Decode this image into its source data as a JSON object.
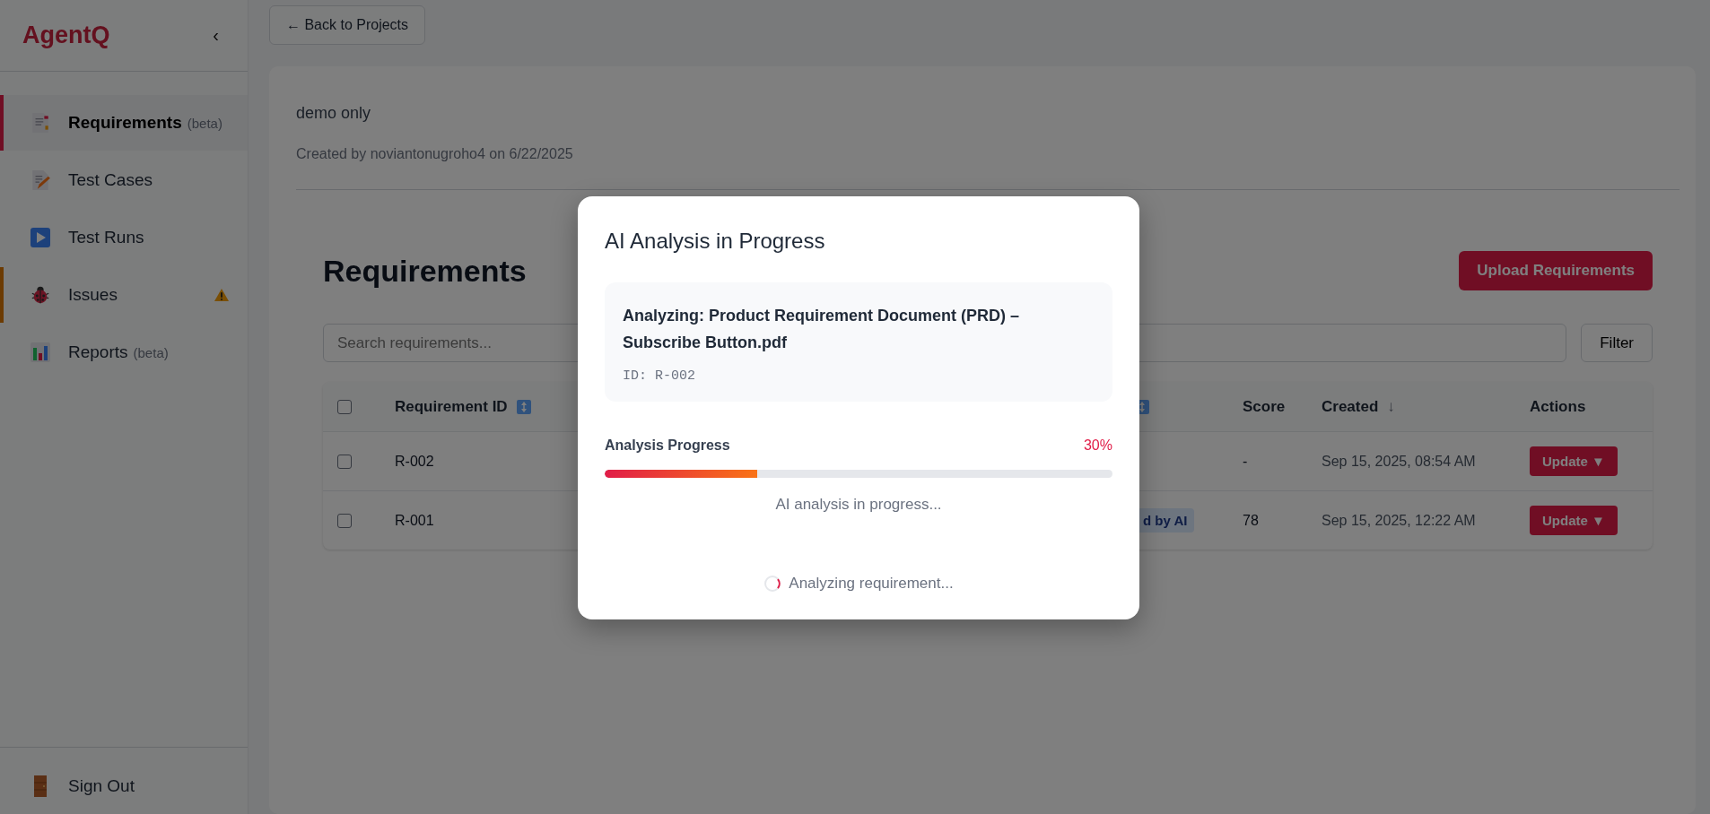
{
  "sidebar": {
    "logo": "AgentQ",
    "collapse": "‹",
    "items": [
      {
        "kind": "document",
        "label": "Requirements",
        "tag": "(beta)",
        "selected": true,
        "alert": false
      },
      {
        "kind": "pencil",
        "label": "Test Cases",
        "selected": false,
        "alert": false
      },
      {
        "kind": "play",
        "label": "Test Runs",
        "selected": false,
        "alert": false
      },
      {
        "kind": "bug",
        "label": "Issues",
        "selected": false,
        "alert": true
      },
      {
        "kind": "chart",
        "label": "Reports",
        "tag": "(beta)",
        "selected": false,
        "alert": false
      }
    ],
    "footer": {
      "kind": "door",
      "label": "Sign Out"
    }
  },
  "back_button": "← Back to Projects",
  "project": {
    "name": "demo only",
    "meta": "Created by noviantonugroho4 on 6/22/2025"
  },
  "page": {
    "title": "Requirements",
    "upload_button": "Upload Requirements",
    "search": {
      "placeholder": "Search requirements..."
    },
    "filter_button": "Filter"
  },
  "table": {
    "select_all_checked": false,
    "columns": [
      {
        "label": "Requirement ID",
        "sortable": true
      },
      {
        "sortable": true
      },
      {
        "label": "Score",
        "sortable": false
      },
      {
        "label": "Created",
        "sort_indicator": "↓",
        "sortable": false
      },
      {
        "label": "Actions",
        "sortable": false
      }
    ],
    "rows": [
      {
        "checked": false,
        "requirement_id": "R-002",
        "score": "-",
        "created": "Sep 15, 2025, 08:54 AM",
        "action": "Update ▼"
      },
      {
        "checked": false,
        "requirement_id": "R-001",
        "column_3": "d by AI",
        "score": "78",
        "created": "Sep 15, 2025, 12:22 AM",
        "action": "Update ▼"
      }
    ]
  },
  "modal": {
    "title": "AI Analysis in Progress",
    "file": "Analyzing: Product Requirement Document (PRD) – Subscribe Button.pdf",
    "id": "ID: R-002",
    "progress_label": "Analysis Progress",
    "percent": "30%",
    "level": 0.3,
    "status": "AI analysis in progress...",
    "footer": "Analyzing requirement..."
  }
}
